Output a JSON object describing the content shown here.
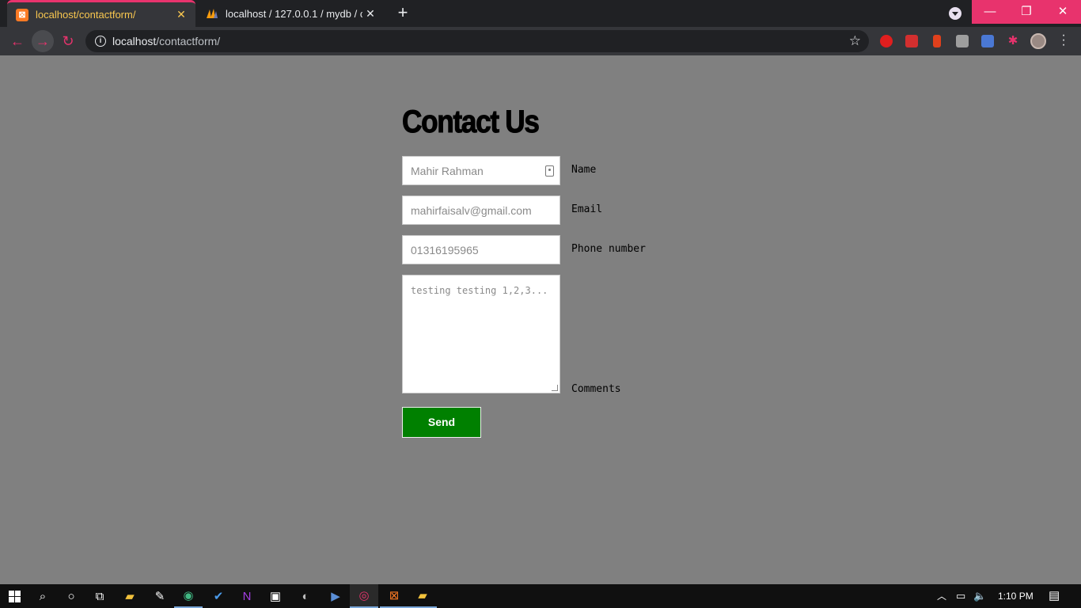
{
  "browser": {
    "tabs": [
      {
        "title": "localhost/contactform/",
        "active": true,
        "icon": "xampp-icon"
      },
      {
        "title": "localhost / 127.0.0.1 / mydb / co",
        "active": false,
        "icon": "phpmyadmin-icon"
      }
    ],
    "url_host": "localhost",
    "url_path": "/contactform/",
    "accent_color": "#e8336d"
  },
  "form": {
    "heading": "Contact Us",
    "name_value": "Mahir Rahman",
    "name_label": "Name",
    "email_value": "mahirfaisalv@gmail.com",
    "email_label": "Email",
    "phone_value": "01316195965",
    "phone_label": "Phone number",
    "comments_value": "testing testing 1,2,3...",
    "comments_label": "Comments",
    "send_label": "Send",
    "send_color": "#008000"
  },
  "taskbar": {
    "time": "1:10 PM"
  }
}
